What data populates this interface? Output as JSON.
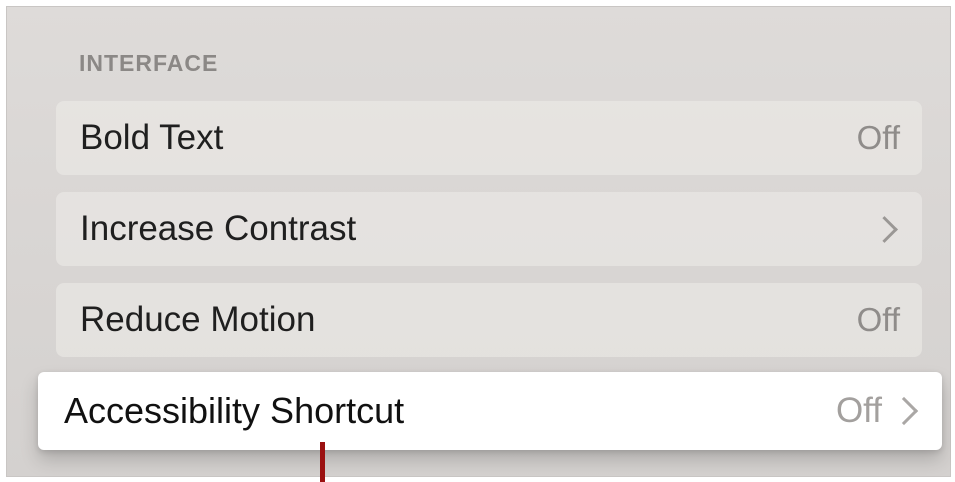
{
  "section": {
    "title": "INTERFACE"
  },
  "rows": [
    {
      "label": "Bold Text",
      "value": "Off",
      "chevron": false
    },
    {
      "label": "Increase Contrast",
      "value": "",
      "chevron": true
    },
    {
      "label": "Reduce Motion",
      "value": "Off",
      "chevron": false
    },
    {
      "label": "Accessibility Shortcut",
      "value": "Off",
      "chevron": true,
      "focused": true
    }
  ],
  "icons": {
    "chevron": "chevron-right-icon"
  },
  "colors": {
    "background": "#dbd8d6",
    "focused_row": "#ffffff",
    "pointer": "#9b1111"
  }
}
